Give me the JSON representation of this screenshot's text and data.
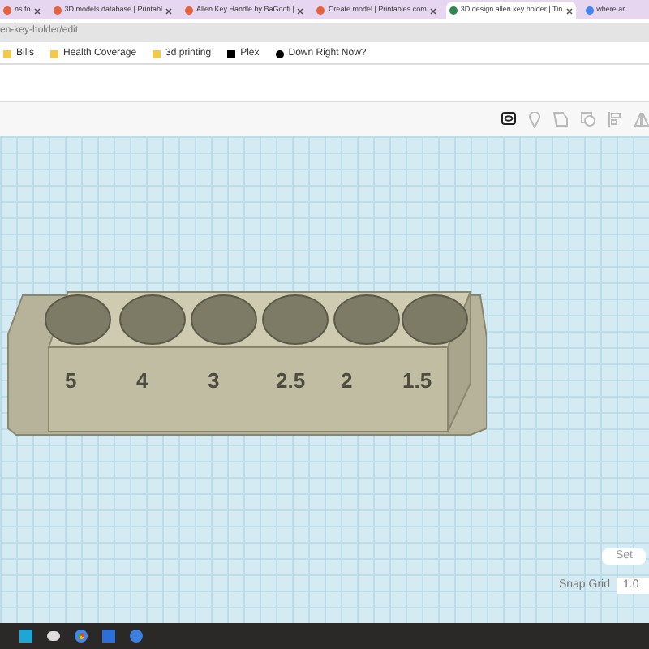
{
  "browser_tabs": [
    {
      "title": "ns fo",
      "selected": false
    },
    {
      "title": "3D models database | Printabl",
      "selected": false
    },
    {
      "title": "Allen Key Handle by BaGoofi |",
      "selected": false
    },
    {
      "title": "Create model | Printables.com",
      "selected": false
    },
    {
      "title": "3D design allen key holder | Tin",
      "selected": true
    },
    {
      "title": "where ar",
      "selected": false
    }
  ],
  "address_bar": {
    "url": "en-key-holder/edit"
  },
  "bookmarks": [
    "Bills",
    "Health Coverage",
    "3d printing",
    "Plex",
    "Down Right Now?"
  ],
  "model": {
    "labels": [
      "5",
      "4",
      "3",
      "2.5",
      "2",
      "1.5"
    ]
  },
  "workplane_controls": {
    "settings": "Set",
    "snap_grid_label": "Snap Grid",
    "snap_grid_value": "1.0"
  }
}
